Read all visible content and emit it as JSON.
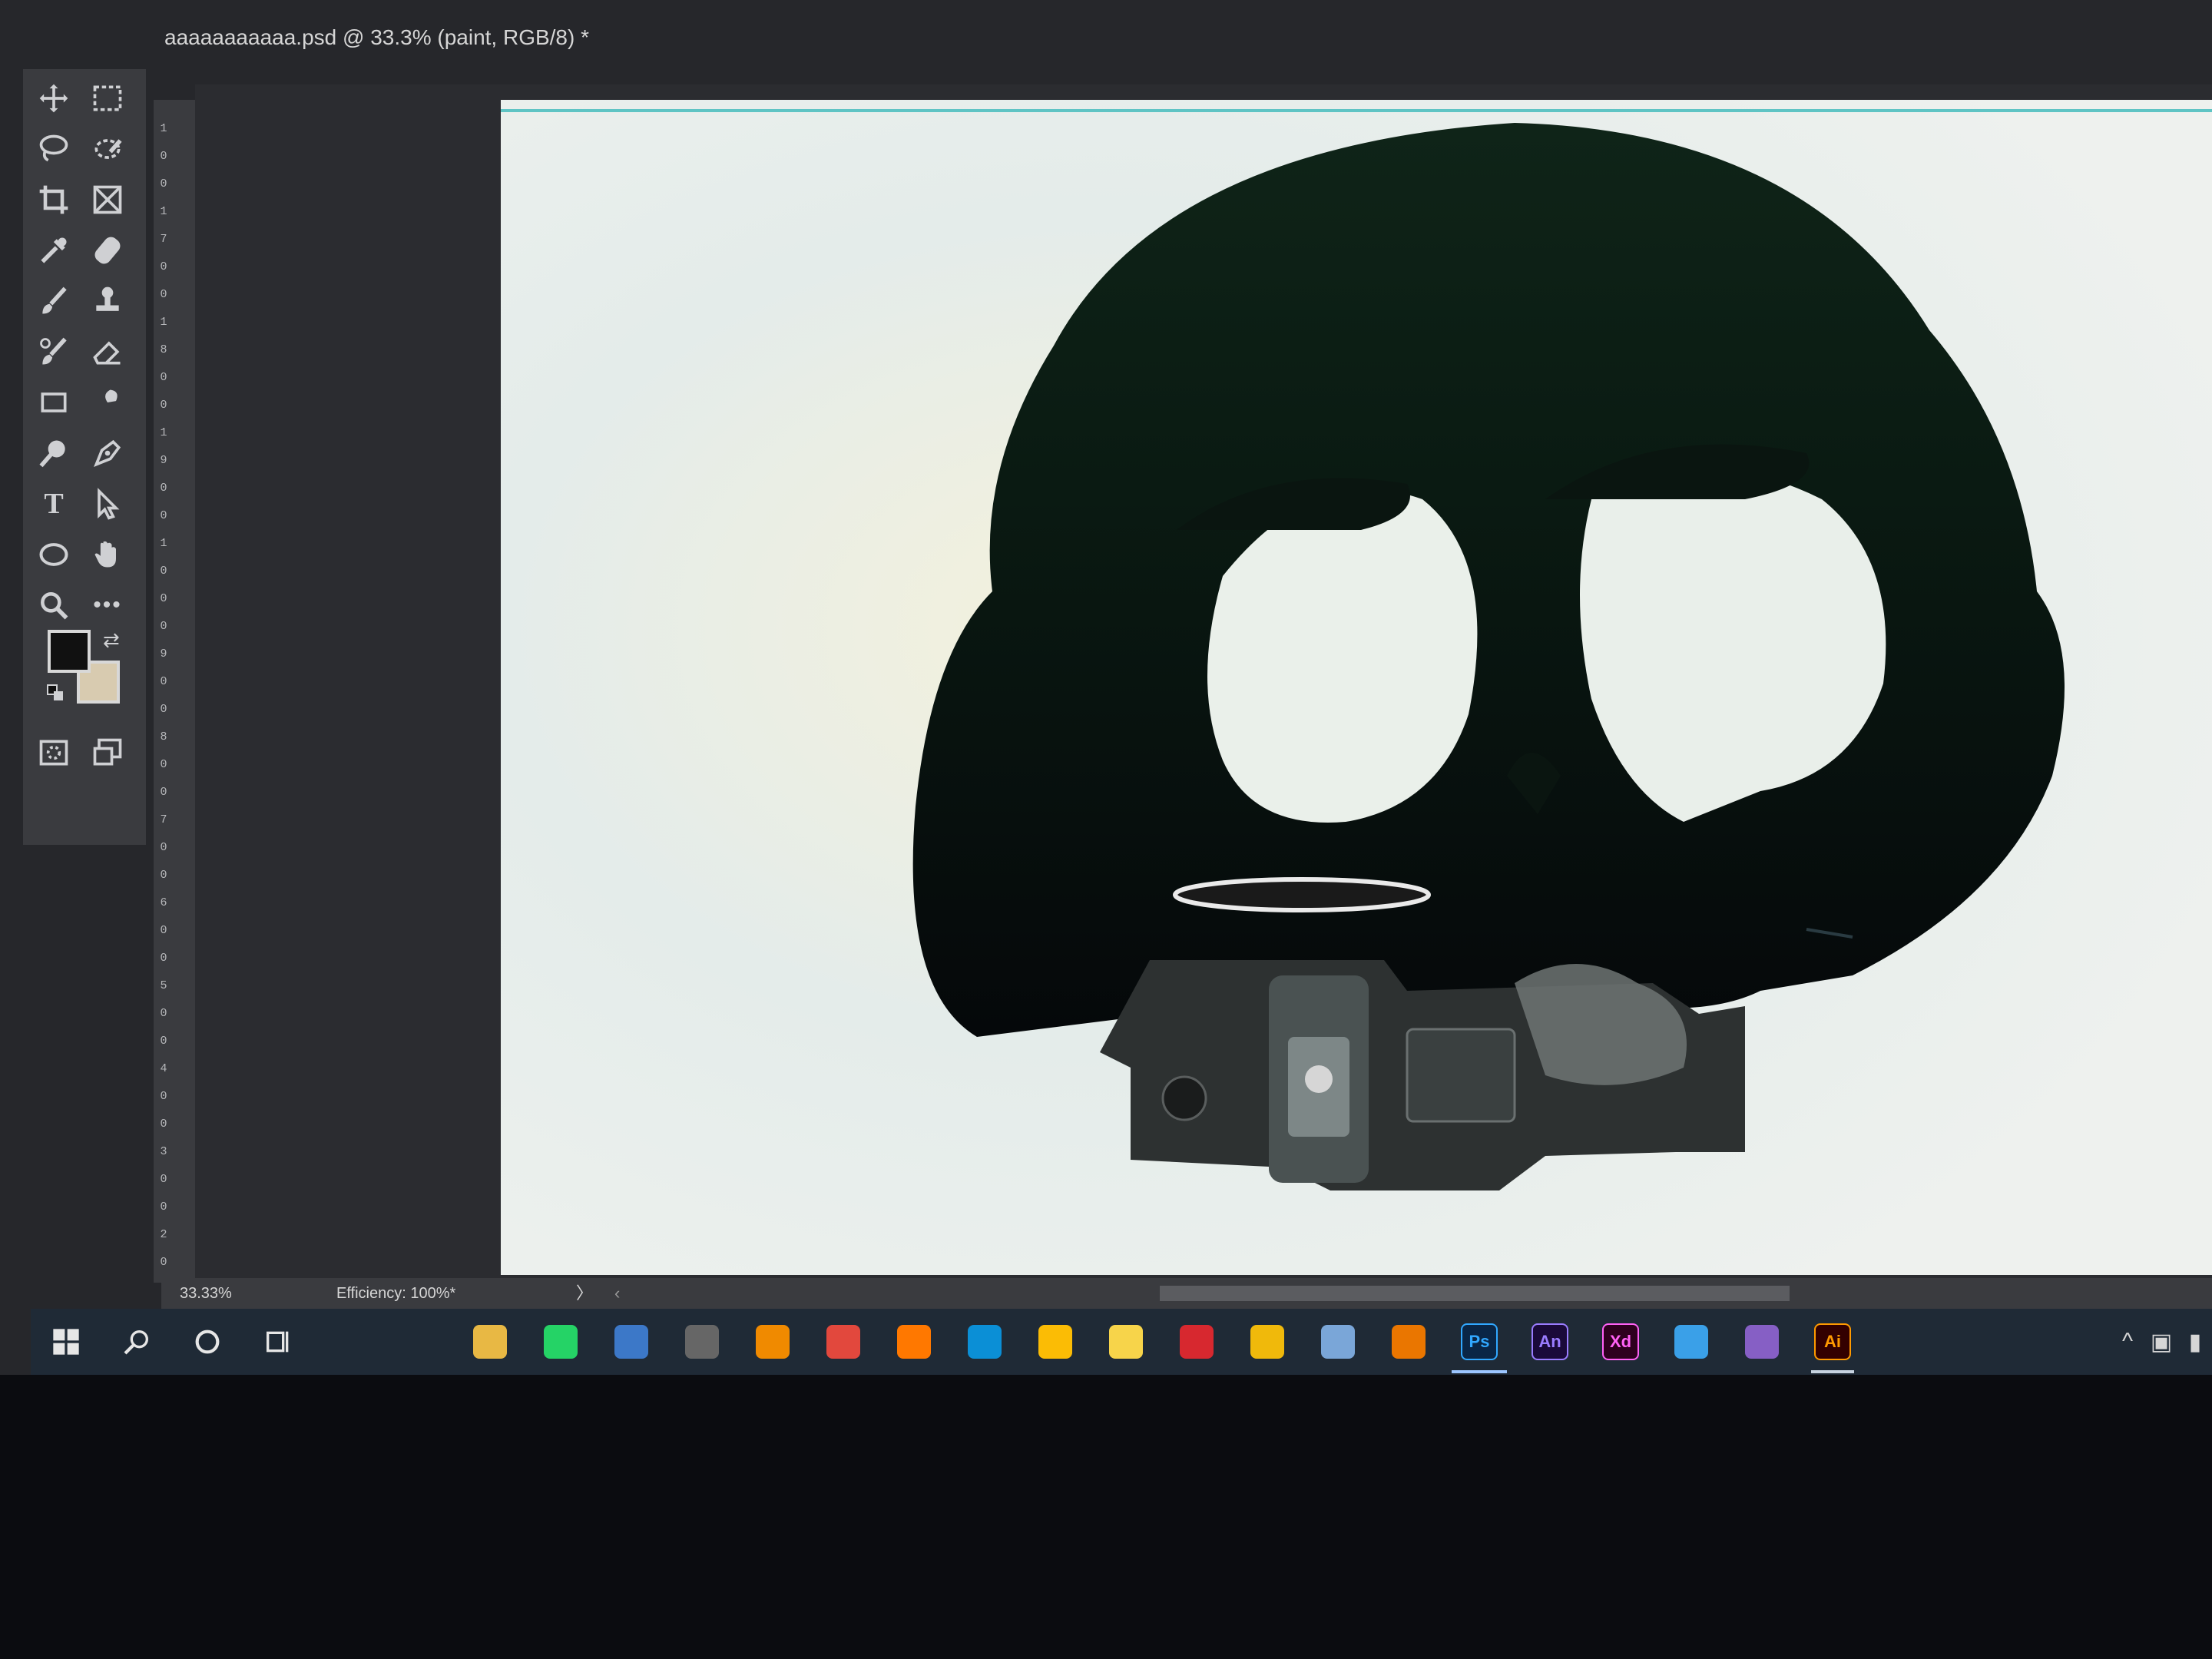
{
  "document": {
    "tab_title": "aaaaaaaaaaa.psd @ 33.3% (paint, RGB/8) *"
  },
  "toolbar": {
    "tools": [
      "move-icon",
      "marquee-icon",
      "lasso-icon",
      "quick-select-icon",
      "crop-icon",
      "frame-icon",
      "eyedropper-icon",
      "healing-brush-icon",
      "brush-icon",
      "clone-stamp-icon",
      "history-brush-icon",
      "eraser-icon",
      "gradient-icon",
      "smudge-icon",
      "dodge-icon",
      "pen-icon",
      "type-icon",
      "path-select-icon",
      "ellipse-icon",
      "hand-icon",
      "zoom-icon",
      "more-tools-icon"
    ],
    "foreground_color": "#111111",
    "background_color": "#d8cbb0"
  },
  "ruler": {
    "labels": [
      "1",
      "0",
      "0",
      "1",
      "7",
      "0",
      "0",
      "1",
      "8",
      "0",
      "0",
      "1",
      "9",
      "0",
      "0",
      "1",
      "0",
      "0",
      "0",
      "9",
      "0",
      "0",
      "8",
      "0",
      "0",
      "7",
      "0",
      "0",
      "6",
      "0",
      "0",
      "5",
      "0",
      "0",
      "4",
      "0",
      "0",
      "3",
      "0",
      "0",
      "2",
      "0"
    ]
  },
  "status": {
    "zoom": "33.33%",
    "efficiency": "Efficiency: 100%*",
    "arrow": "〉",
    "left_arrow": "‹"
  },
  "taskbar": {
    "items": [
      {
        "name": "start",
        "label": "",
        "color": "#1f2a36"
      },
      {
        "name": "search",
        "label": "",
        "color": "#1f2a36"
      },
      {
        "name": "cortana",
        "label": "",
        "color": "#1f2a36"
      },
      {
        "name": "task-view",
        "label": "",
        "color": "#1f2a36"
      },
      {
        "name": "store",
        "label": "",
        "color": "#1f2a36"
      },
      {
        "name": "mail",
        "label": "",
        "color": "#1f2a36"
      },
      {
        "name": "file-explorer",
        "label": "",
        "color": "#e8b844"
      },
      {
        "name": "whatsapp",
        "label": "",
        "color": "#25d366"
      },
      {
        "name": "photos",
        "label": "",
        "color": "#3c78c8"
      },
      {
        "name": "groove",
        "label": "",
        "color": "#666"
      },
      {
        "name": "vlc",
        "label": "",
        "color": "#f08a00"
      },
      {
        "name": "app-red",
        "label": "",
        "color": "#e2483d"
      },
      {
        "name": "avast",
        "label": "",
        "color": "#ff7800"
      },
      {
        "name": "edge",
        "label": "",
        "color": "#0b8fd6"
      },
      {
        "name": "chrome",
        "label": "",
        "color": "#fbbc05"
      },
      {
        "name": "notes",
        "label": "",
        "color": "#f7d44a"
      },
      {
        "name": "acrobat",
        "label": "",
        "color": "#d7282f"
      },
      {
        "name": "binance",
        "label": "",
        "color": "#f0b90b"
      },
      {
        "name": "paint",
        "label": "",
        "color": "#7aa6d8"
      },
      {
        "name": "blender",
        "label": "",
        "color": "#ea7600"
      },
      {
        "name": "photoshop",
        "label": "Ps",
        "color": "#0a2646",
        "fg": "#31a8ff"
      },
      {
        "name": "animate",
        "label": "An",
        "color": "#1a0a3a",
        "fg": "#9a7cff"
      },
      {
        "name": "xd",
        "label": "Xd",
        "color": "#2e001f",
        "fg": "#ff61f6"
      },
      {
        "name": "tool-blue",
        "label": "",
        "color": "#3aa0e8"
      },
      {
        "name": "visual-studio",
        "label": "",
        "color": "#865fc5"
      },
      {
        "name": "illustrator",
        "label": "Ai",
        "color": "#330000",
        "fg": "#ff9a00"
      }
    ]
  }
}
